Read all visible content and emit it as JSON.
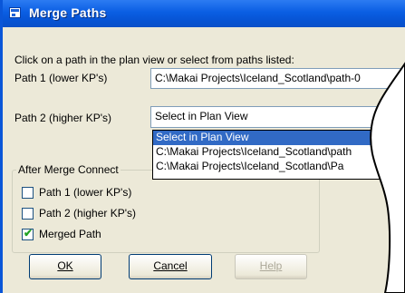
{
  "window": {
    "title": "Merge Paths"
  },
  "instruction": "Click on a path in the plan view or select from paths listed:",
  "path1": {
    "label": "Path 1 (lower KP's)",
    "value": "C:\\Makai Projects\\Iceland_Scotland\\path-0"
  },
  "path2": {
    "label": "Path 2 (higher KP's)",
    "value": "Select in Plan View",
    "options": [
      "Select in Plan View",
      "C:\\Makai Projects\\Iceland_Scotland\\path",
      "C:\\Makai Projects\\Iceland_Scotland\\Pa"
    ]
  },
  "after_merge": {
    "title": "After Merge Connect",
    "items": [
      {
        "label": "Path 1  (lower KP's)",
        "checked": false
      },
      {
        "label": "Path 2  (higher KP's)",
        "checked": false
      },
      {
        "label": "Merged Path",
        "checked": true
      }
    ]
  },
  "buttons": {
    "ok": "OK",
    "cancel": "Cancel",
    "help": "Help"
  },
  "colors": {
    "titlebar": "#0a5ee3",
    "selection": "#316ac5",
    "dialog": "#ece9d8"
  }
}
